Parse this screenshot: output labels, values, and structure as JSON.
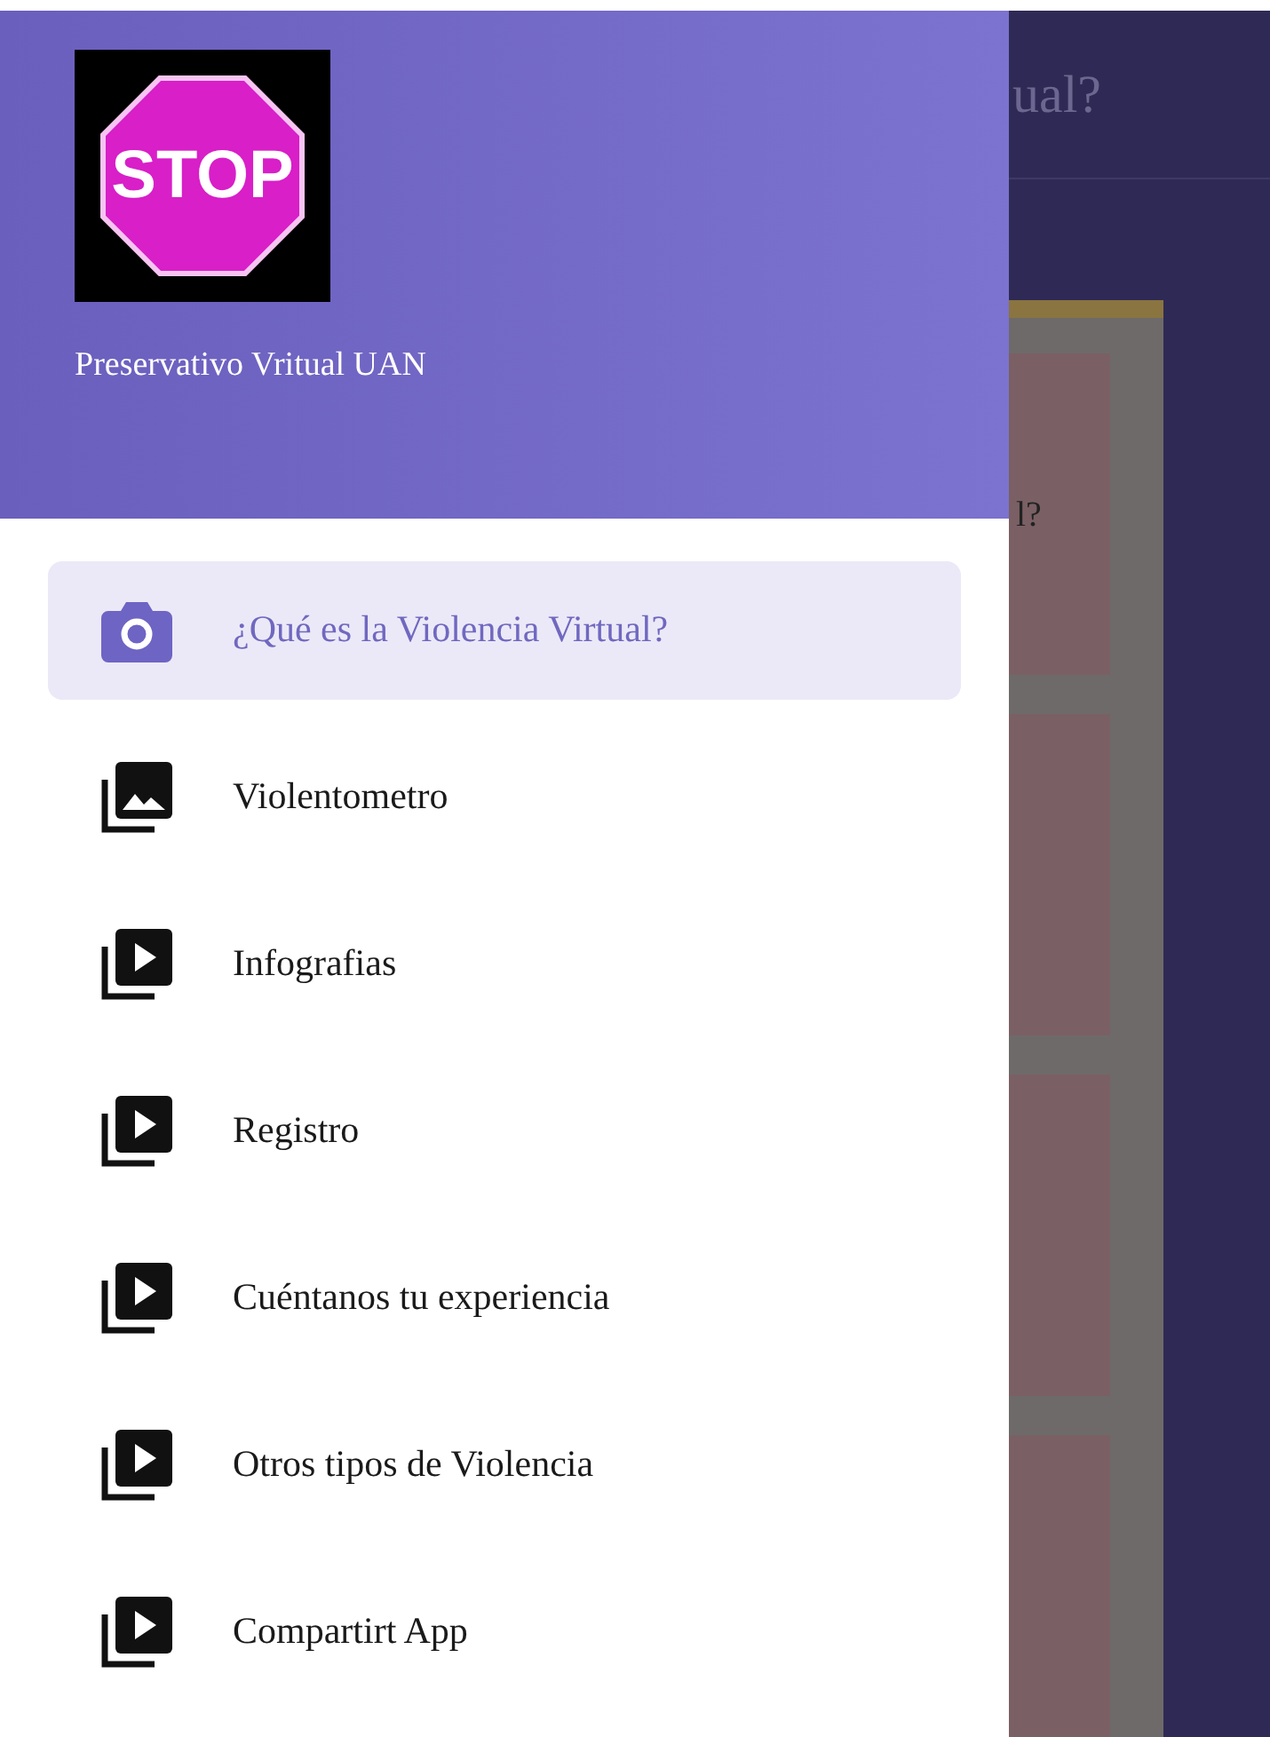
{
  "background_app": {
    "title_fragment": "ual?",
    "card_text_fragment": "l?"
  },
  "drawer": {
    "logo_text": "STOP",
    "app_name": "Preservativo Vritual UAN",
    "items": [
      {
        "label": "¿Qué es la Violencia Virtual?",
        "kind": "camera",
        "selected": true
      },
      {
        "label": "Violentometro",
        "kind": "photos",
        "selected": false
      },
      {
        "label": "Infografias",
        "kind": "videos",
        "selected": false
      },
      {
        "label": "Registro",
        "kind": "videos",
        "selected": false
      },
      {
        "label": "Cuéntanos tu experiencia",
        "kind": "videos",
        "selected": false
      },
      {
        "label": "Otros tipos de Violencia",
        "kind": "videos",
        "selected": false
      },
      {
        "label": "Compartirt App",
        "kind": "videos",
        "selected": false
      }
    ]
  }
}
